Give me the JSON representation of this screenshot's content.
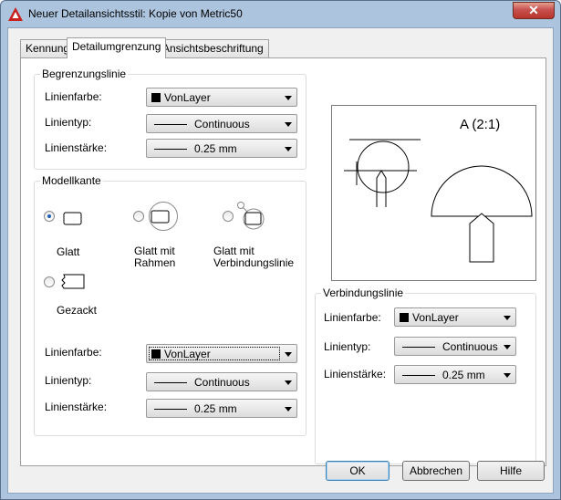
{
  "window": {
    "title": "Neuer Detailansichtsstil: Kopie von Metric50",
    "close_label": "✕"
  },
  "tabs": [
    {
      "label": "Kennung"
    },
    {
      "label": "Detailumgrenzung"
    },
    {
      "label": "Ansichtsbeschriftung"
    }
  ],
  "boundary": {
    "title": "Begrenzungslinie",
    "color_label": "Linienfarbe:",
    "color_value": "VonLayer",
    "type_label": "Linientyp:",
    "type_value": "Continuous",
    "weight_label": "Linienstärke:",
    "weight_value": "0.25 mm"
  },
  "model_edge": {
    "title": "Modellkante",
    "options": [
      {
        "label": "Glatt",
        "selected": true
      },
      {
        "label": "Glatt mit Rahmen",
        "selected": false
      },
      {
        "label": "Glatt mit Verbindungslinie",
        "selected": false
      },
      {
        "label": "Gezackt",
        "selected": false
      }
    ],
    "color_label": "Linienfarbe:",
    "color_value": "VonLayer",
    "type_label": "Linientyp:",
    "type_value": "Continuous",
    "weight_label": "Linienstärke:",
    "weight_value": "0.25 mm"
  },
  "preview": {
    "label": "A (2:1)"
  },
  "connection": {
    "title": "Verbindungslinie",
    "color_label": "Linienfarbe:",
    "color_value": "VonLayer",
    "type_label": "Linientyp:",
    "type_value": "Continuous",
    "weight_label": "Linienstärke:",
    "weight_value": "0.25 mm"
  },
  "buttons": {
    "ok": "OK",
    "cancel": "Abbrechen",
    "help": "Hilfe"
  },
  "colors": {
    "window_frame": "#adc4de",
    "close_button": "#c75050",
    "radio_dot": "#1e5fb4",
    "default_button_border": "#3c7fb1"
  }
}
